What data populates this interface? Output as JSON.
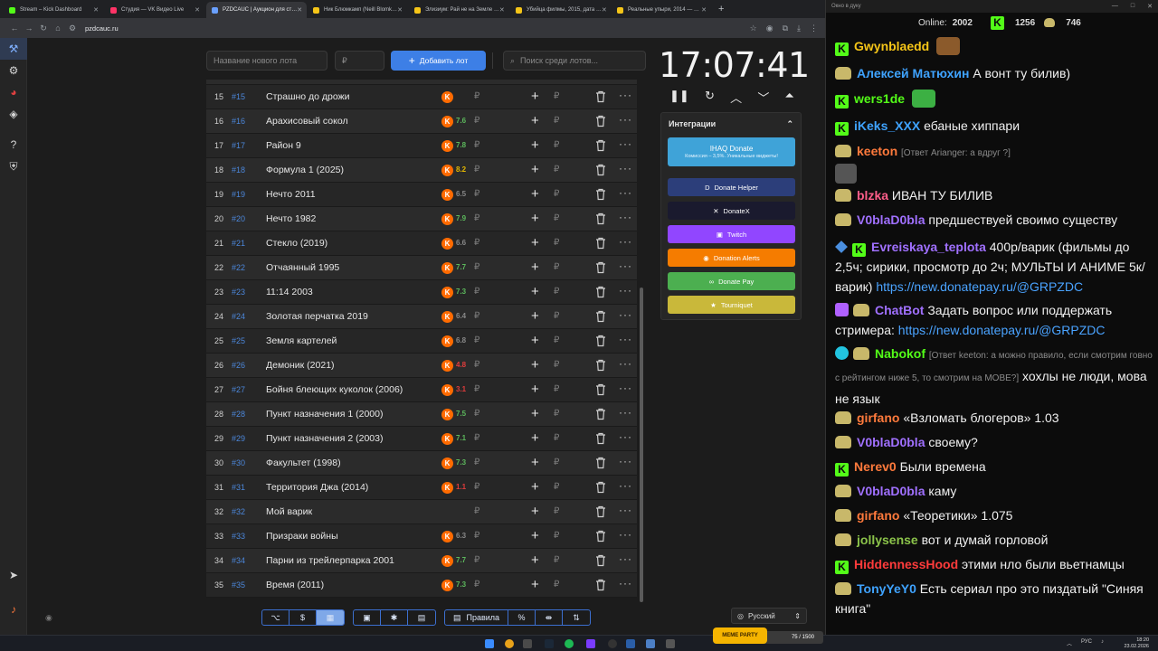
{
  "browser": {
    "tabs": [
      {
        "title": "Stream – Kick Dashboard",
        "color": "#53fc18"
      },
      {
        "title": "Студия — VK Видео Live",
        "color": "#ff3366"
      },
      {
        "title": "PZDCAUC | Аукцион для ст…",
        "color": "#6aa0ff",
        "active": true
      },
      {
        "title": "Ник Блюмкамп (Neill Blomk…",
        "color": "#f5c518"
      },
      {
        "title": "Элизиум: Рай не на Земле …",
        "color": "#f5c518"
      },
      {
        "title": "Убийца филмы, 2015, дата …",
        "color": "#f5c518"
      },
      {
        "title": "Реальные упыри, 2014 — …",
        "color": "#f5c518"
      }
    ],
    "new_tab": "+",
    "url": "pzdcauc.ru",
    "window_controls": [
      "▾",
      "—",
      "□",
      "✕"
    ]
  },
  "sidebar": {
    "icons": [
      "auction-icon",
      "settings-icon",
      "chart-wheel-icon",
      "layers-icon",
      "help-icon",
      "shield-icon",
      "telegram-icon",
      "brand-icon"
    ]
  },
  "toolbar": {
    "new_lot_placeholder": "Название нового лота",
    "price_placeholder": "₽",
    "add_lot_label": "Добавить лот",
    "search_placeholder": "Поиск среди лотов..."
  },
  "lots": [
    {
      "n": "15",
      "id": "#15",
      "name": "Страшно до дрожи",
      "rating": "",
      "rc": ""
    },
    {
      "n": "16",
      "id": "#16",
      "name": "Арахисовый сокол",
      "rating": "7.6",
      "rc": "#5cb85c"
    },
    {
      "n": "17",
      "id": "#17",
      "name": "Район 9",
      "rating": "7.8",
      "rc": "#5cb85c"
    },
    {
      "n": "18",
      "id": "#18",
      "name": "Формула 1 (2025)",
      "rating": "8.2",
      "rc": "#e6b800"
    },
    {
      "n": "19",
      "id": "#19",
      "name": "Нечто 2011",
      "rating": "6.5",
      "rc": "#888888"
    },
    {
      "n": "20",
      "id": "#20",
      "name": "Нечто 1982",
      "rating": "7.9",
      "rc": "#5cb85c"
    },
    {
      "n": "21",
      "id": "#21",
      "name": "Стекло (2019)",
      "rating": "6.6",
      "rc": "#888888"
    },
    {
      "n": "22",
      "id": "#22",
      "name": "Отчаянный 1995",
      "rating": "7.7",
      "rc": "#5cb85c"
    },
    {
      "n": "23",
      "id": "#23",
      "name": "11:14 2003",
      "rating": "7.3",
      "rc": "#5cb85c"
    },
    {
      "n": "24",
      "id": "#24",
      "name": "Золотая перчатка 2019",
      "rating": "6.4",
      "rc": "#888888"
    },
    {
      "n": "25",
      "id": "#25",
      "name": "Земля картелей",
      "rating": "6.8",
      "rc": "#888888"
    },
    {
      "n": "26",
      "id": "#26",
      "name": "Демоник (2021)",
      "rating": "4.8",
      "rc": "#e03c3c"
    },
    {
      "n": "27",
      "id": "#27",
      "name": "Бойня блеющих куколок (2006)",
      "rating": "3.1",
      "rc": "#e03c3c"
    },
    {
      "n": "28",
      "id": "#28",
      "name": "Пункт назначения 1 (2000)",
      "rating": "7.5",
      "rc": "#5cb85c"
    },
    {
      "n": "29",
      "id": "#29",
      "name": "Пункт назначения 2 (2003)",
      "rating": "7.1",
      "rc": "#5cb85c"
    },
    {
      "n": "30",
      "id": "#30",
      "name": "Факультет (1998)",
      "rating": "7.3",
      "rc": "#5cb85c"
    },
    {
      "n": "31",
      "id": "#31",
      "name": "Территория Джа (2014)",
      "rating": "1.1",
      "rc": "#e03c3c"
    },
    {
      "n": "32",
      "id": "#32",
      "name": "Мой варик",
      "rating": "",
      "rc": "",
      "nokp": true
    },
    {
      "n": "33",
      "id": "#33",
      "name": "Призраки войны",
      "rating": "6.3",
      "rc": "#888888"
    },
    {
      "n": "34",
      "id": "#34",
      "name": "Парни из трейлерпарка 2001",
      "rating": "7.7",
      "rc": "#5cb85c"
    },
    {
      "n": "35",
      "id": "#35",
      "name": "Время (2011)",
      "rating": "7.3",
      "rc": "#5cb85c"
    }
  ],
  "timer": {
    "time": "17:07:41",
    "controls": [
      "❚❚",
      "↻",
      "︿",
      "﹀",
      "⏶"
    ]
  },
  "integrations": {
    "title": "Интеграции",
    "collapse": "⌃",
    "ihaq": {
      "label": "IHAQ Donate",
      "sub": "Комиссия – 3,5%. Уникальные виджеты!",
      "color": "#3fa3d8"
    },
    "buttons": [
      {
        "label": "Donate Helper",
        "color": "#2c3e7a"
      },
      {
        "label": "DonateX",
        "color": "#1a1a2e"
      },
      {
        "label": "Twitch",
        "color": "#9146ff"
      },
      {
        "label": "Donation Alerts",
        "color": "#f57c00"
      },
      {
        "label": "Donate Pay",
        "color": "#4caf50"
      },
      {
        "label": "Tourniquet",
        "color": "#c9b83a"
      }
    ]
  },
  "bottom_bar": {
    "group1": [
      "⌥",
      "$",
      "▦"
    ],
    "group2": [
      "▣",
      "✱",
      "▤"
    ],
    "rules_label": "Правила",
    "group3": [
      "%",
      "⇼",
      "⇅"
    ],
    "language": "Русский"
  },
  "chat_window": {
    "title": "Окно в дуку",
    "online_label": "Online:",
    "online_count": "2002",
    "stat1": "1256",
    "stat2": "746"
  },
  "chat": [
    {
      "badge": "k",
      "user": "Gwynblaedd",
      "color": "#f5c518",
      "text": "",
      "emote": "#8b5a2b"
    },
    {
      "badge": "b",
      "user": "Алексей Матюхин",
      "color": "#3fa3ff",
      "text": "А вонт ту билив)"
    },
    {
      "badge": "k",
      "user": "wers1de",
      "color": "#53fc18",
      "text": "",
      "emote": "#3cb043"
    },
    {
      "badge": "k",
      "user": "iKeks_XXX",
      "color": "#3fa3ff",
      "text": "ебаные хиппари"
    },
    {
      "badge": "b",
      "user": "keeton",
      "color": "#ff7a3c",
      "reply": "[Ответ Arianger: а вдруг ?]",
      "text": ""
    },
    {
      "badge": "b",
      "user": "blzka",
      "color": "#ff5e8a",
      "text": "ИВАН ТУ БИЛИВ"
    },
    {
      "badge": "b",
      "user": "V0blaD0bla",
      "color": "#a070ff",
      "text": "предшествуей своимо существу"
    },
    {
      "badge": "s",
      "user": "Evreiskaya_teplota",
      "color": "#a070ff",
      "text": "400р/варик (фильмы до 2,5ч; сирики, просмотр до 2ч; МУЛЬТЫ И АНИМЕ 5к/варик)",
      "link": "https://new.donatepay.ru/@GRPZDC"
    },
    {
      "badge": "c",
      "user": "ChatBot",
      "color": "#a070ff",
      "text": "Задать вопрос или поддержать стримера:",
      "link": "https://new.donatepay.ru/@GRPZDC"
    },
    {
      "badge": "t",
      "user": "Nabokof",
      "color": "#53fc18",
      "reply": "[Ответ keeton: а можно правило, если смотрим говно с рейтингом ниже 5, то смотрим на МОВЕ?]",
      "text": "хохлы не люди, мова не язык"
    },
    {
      "badge": "b",
      "user": "girfano",
      "color": "#ff7a3c",
      "text": "«Взломать блогеров»  1.03"
    },
    {
      "badge": "b",
      "user": "V0blaD0bla",
      "color": "#a070ff",
      "text": "своему?"
    },
    {
      "badge": "k",
      "user": "Nerev0",
      "color": "#ff7a3c",
      "text": "Были времена"
    },
    {
      "badge": "b",
      "user": "V0blaD0bla",
      "color": "#a070ff",
      "text": "каму"
    },
    {
      "badge": "b",
      "user": "girfano",
      "color": "#ff7a3c",
      "text": "«Теоретики»  1.075"
    },
    {
      "badge": "b",
      "user": "jollysense",
      "color": "#8bc34a",
      "text": "вот и думай горловой"
    },
    {
      "badge": "k",
      "user": "HiddennessHood",
      "color": "#ff3b3b",
      "text": "этими нло были вьетнамцы"
    },
    {
      "badge": "b",
      "user": "TonyYeY0",
      "color": "#3fa3ff",
      "text": "Есть сериал про это пиздатый \"Синяя книга\""
    }
  ],
  "taskbar": {
    "meme_label": "MEME PARTY",
    "meme_progress": "75 / 1500",
    "lang": "РУС",
    "time": "18:20",
    "date": "23.02.2026"
  }
}
